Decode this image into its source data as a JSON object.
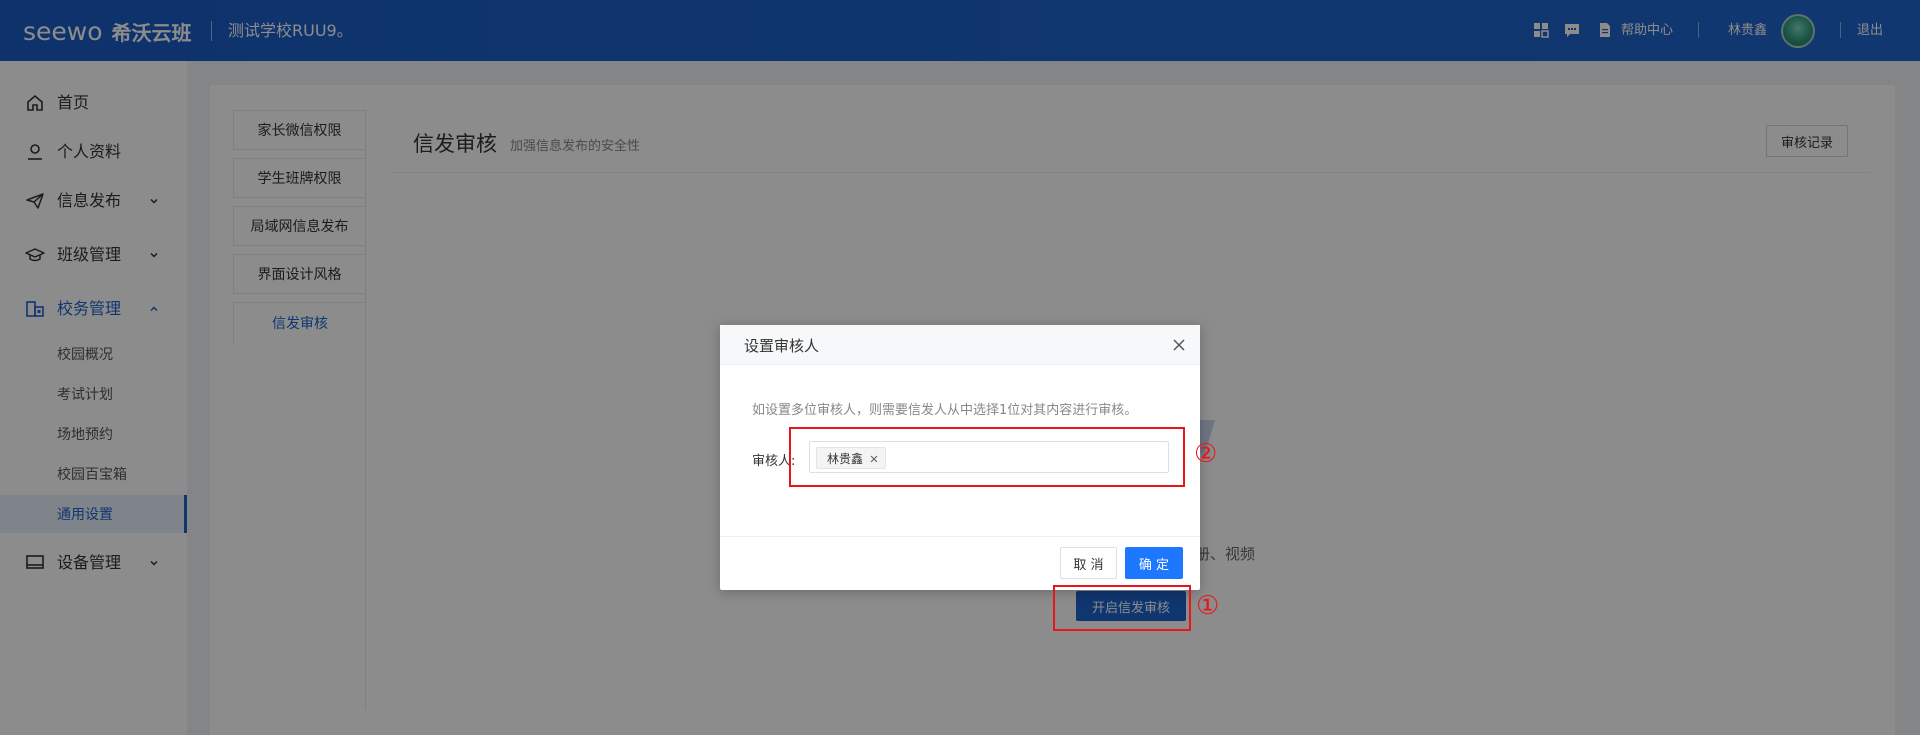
{
  "header": {
    "logo": "seewo",
    "brand_name": "希沃云班",
    "school_name": "测试学校RUU9。",
    "help_center": "帮助中心",
    "user_name": "林贵鑫",
    "logout": "退出",
    "icons": [
      "grid-icon",
      "message-icon",
      "document-icon"
    ]
  },
  "sidebar": {
    "items": [
      {
        "label": "首页",
        "icon": "home-icon"
      },
      {
        "label": "个人资料",
        "icon": "user-icon"
      },
      {
        "label": "信息发布",
        "icon": "send-icon",
        "expandable": true
      },
      {
        "label": "班级管理",
        "icon": "graduation-cap-icon",
        "expandable": true
      },
      {
        "label": "校务管理",
        "icon": "building-icon",
        "expandable": true,
        "expanded": true
      },
      {
        "label": "设备管理",
        "icon": "monitor-icon",
        "expandable": true
      }
    ],
    "sub_items": [
      {
        "label": "校园概况"
      },
      {
        "label": "考试计划"
      },
      {
        "label": "场地预约"
      },
      {
        "label": "校园百宝箱"
      },
      {
        "label": "通用设置",
        "selected": true
      }
    ]
  },
  "tabs": [
    {
      "label": "家长微信权限"
    },
    {
      "label": "学生班牌权限"
    },
    {
      "label": "局域网信息发布"
    },
    {
      "label": "界面设计风格"
    },
    {
      "label": "信发审核",
      "active": true
    }
  ],
  "main": {
    "title": "信发审核",
    "subtitle": "加强信息发布的安全性",
    "record_button": "审核记录",
    "bg_text": "册、视频",
    "start_button": "开启信发审核"
  },
  "dialog": {
    "title": "设置审核人",
    "tip": "如设置多位审核人，则需要信发人从中选择1位对其内容进行审核。",
    "label": "审核人:",
    "selected_tag": "林贵鑫",
    "cancel": "取 消",
    "confirm": "确 定"
  },
  "annotations": {
    "mark_1": "①",
    "mark_2": "②",
    "color": "#e8161b"
  },
  "colors": {
    "primary": "#1e63cc",
    "confirm": "#1e78ff"
  }
}
